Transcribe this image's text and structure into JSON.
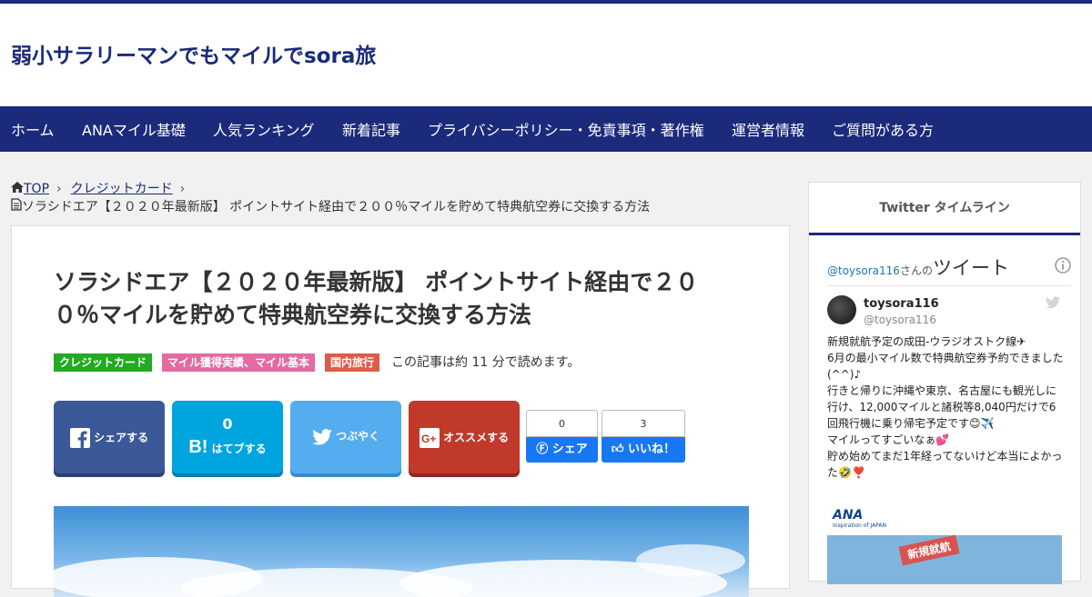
{
  "site": {
    "title": "弱小サラリーマンでもマイルでsora旅"
  },
  "nav": [
    "ホーム",
    "ANAマイル基礎",
    "人気ランキング",
    "新着記事",
    "プライバシーポリシー・免責事項・著作権",
    "運営者情報",
    "ご質問がある方"
  ],
  "breadcrumb": {
    "top": "TOP",
    "category": "クレジットカード",
    "current": "ソラシドエア【２０２０年最新版】 ポイントサイト経由で２００％マイルを貯めて特典航空券に交換する方法"
  },
  "article": {
    "title_line1": "ソラシドエア【２０２０年最新版】 ポイントサイト経由で２０",
    "title_line2": "０％マイルを貯めて特典航空券に交換する方法",
    "tags": [
      {
        "label": "クレジットカード",
        "color": "#22aa22"
      },
      {
        "label": "マイル獲得実績、マイル基本",
        "color": "#e46aa2"
      },
      {
        "label": "国内旅行",
        "color": "#e05a4a"
      }
    ],
    "read_time": "この記事は約 11 分で読めます。"
  },
  "share": {
    "facebook": "シェアする",
    "hatena_count": "0",
    "hatena": "はてブする",
    "twitter": "つぶやく",
    "google": "オススメする",
    "fb_share_count": "0",
    "fb_share": "シェア",
    "fb_like_count": "3",
    "fb_like": "いいね！"
  },
  "sidebar": {
    "heading": "Twitter タイムライン",
    "handle": "@toysora116",
    "san": "さんの",
    "tweet_label": "ツイート",
    "user_name": "toysora116",
    "user_handle": "@toysora116",
    "body": [
      "新規就航予定の成田-ウラジオストク線✈",
      "6月の最小マイル数で特典航空券予約できました(^^)♪",
      "行きと帰りに沖縄や東京、名古屋にも観光しに行け、12,000マイルと諸税等8,040円だけで6回飛行機に乗り帰宅予定です😊✈️",
      "マイルってすごいなぁ💕",
      "貯め始めてまだ1年経ってないけど本当によかった🤣❣️"
    ],
    "ana_logo": "ANA",
    "ana_tagline": "Inspiration of JAPAN",
    "banner": "新規就航"
  },
  "colors": {
    "brand": "#1b2a7a",
    "facebook": "#3b5998",
    "hatena": "#00a4de",
    "twitter": "#55acee",
    "google": "#c0392b"
  }
}
